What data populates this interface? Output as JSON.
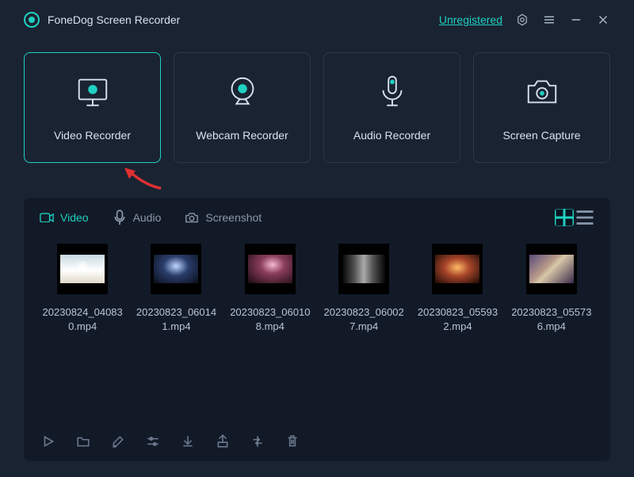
{
  "app": {
    "title": "FoneDog Screen Recorder",
    "status": "Unregistered"
  },
  "modes": [
    {
      "id": "video-recorder",
      "label": "Video Recorder",
      "icon": "monitor-record",
      "active": true
    },
    {
      "id": "webcam-recorder",
      "label": "Webcam Recorder",
      "icon": "webcam",
      "active": false
    },
    {
      "id": "audio-recorder",
      "label": "Audio Recorder",
      "icon": "microphone",
      "active": false
    },
    {
      "id": "screen-capture",
      "label": "Screen Capture",
      "icon": "camera",
      "active": false
    }
  ],
  "tabs": [
    {
      "id": "video",
      "label": "Video",
      "active": true
    },
    {
      "id": "audio",
      "label": "Audio",
      "active": false
    },
    {
      "id": "screenshot",
      "label": "Screenshot",
      "active": false
    }
  ],
  "files": [
    {
      "name": "20230824_040830.mp4",
      "thumb": "sky"
    },
    {
      "name": "20230823_060141.mp4",
      "thumb": "crowd1"
    },
    {
      "name": "20230823_060108.mp4",
      "thumb": "crowd2"
    },
    {
      "name": "20230823_060027.mp4",
      "thumb": "dark"
    },
    {
      "name": "20230823_055932.mp4",
      "thumb": "concert"
    },
    {
      "name": "20230823_055736.mp4",
      "thumb": "person"
    }
  ],
  "toolbar": [
    {
      "id": "play",
      "icon": "play"
    },
    {
      "id": "folder",
      "icon": "folder"
    },
    {
      "id": "edit",
      "icon": "pencil"
    },
    {
      "id": "settings",
      "icon": "sliders"
    },
    {
      "id": "download",
      "icon": "download"
    },
    {
      "id": "export",
      "icon": "export"
    },
    {
      "id": "convert",
      "icon": "convert"
    },
    {
      "id": "delete",
      "icon": "trash"
    }
  ]
}
